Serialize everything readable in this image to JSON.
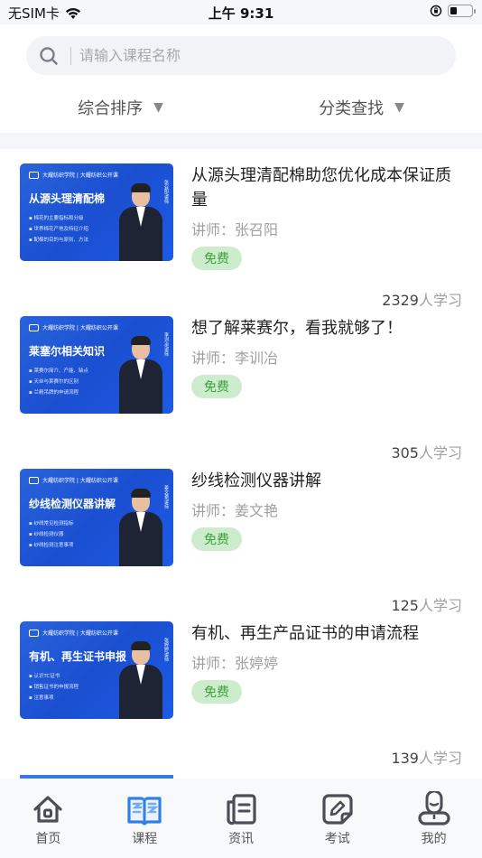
{
  "status_bar": {
    "carrier": "无SIM卡",
    "time": "上午 9:31",
    "battery_level": 0.3
  },
  "search": {
    "placeholder": "请输入课程名称",
    "value": ""
  },
  "filters": [
    {
      "label": "综合排序",
      "arrow": "▼"
    },
    {
      "label": "分类查找",
      "arrow": "▼"
    }
  ],
  "courses": [
    {
      "title": "从源头理清配棉助您优化成本保证质量",
      "lecturer": "讲师：张召阳",
      "badge": "免费",
      "learners_count": "2329",
      "learners_suffix": "人学习",
      "thumb": {
        "header": "大耀纺织学院 | 大耀纺织公开课",
        "title": "从源头理清配棉",
        "bullets": [
          "棉花的主要指标和分级",
          "世界棉花产地及特征介绍",
          "配棉的目的与原则、方法"
        ],
        "name_tag": "张召阳/讲师"
      }
    },
    {
      "title": "想了解莱赛尔，看我就够了！",
      "lecturer": "讲师：李训冶",
      "badge": "免费",
      "learners_count": "305",
      "learners_suffix": "人学习",
      "thumb": {
        "header": "大耀纺织学院 | 大耀纺织公开课",
        "title": "莱塞尔相关知识",
        "bullets": [
          "莱赛尔简介、产能、缺点",
          "天丝与莱赛尔的区别",
          "兰精吊牌的申请流程"
        ],
        "name_tag": "李训冶/讲师"
      }
    },
    {
      "title": "纱线检测仪器讲解",
      "lecturer": "讲师：姜文艳",
      "badge": "免费",
      "learners_count": "125",
      "learners_suffix": "人学习",
      "thumb": {
        "header": "大耀纺织学院 | 大耀纺织公开课",
        "title": "纱线检测仪器讲解",
        "bullets": [
          "纱线常见检测指标",
          "纱线检测仪器",
          "纱线检测注意事项"
        ],
        "name_tag": "姜文艳/讲师"
      }
    },
    {
      "title": "有机、再生产品证书的申请流程",
      "lecturer": "讲师：张婷婷",
      "badge": "免费",
      "learners_count": "139",
      "learners_suffix": "人学习",
      "thumb": {
        "header": "大耀纺织学院 | 大耀纺织公开课",
        "title": "有机、再生证书申报",
        "bullets": [
          "认识TC证书",
          "销售证书的申报流程",
          "注意事项"
        ],
        "name_tag": "张婷婷/讲师"
      }
    }
  ],
  "tabs": [
    {
      "label": "首页",
      "icon": "home-icon",
      "active": false
    },
    {
      "label": "课程",
      "icon": "book-icon",
      "active": true
    },
    {
      "label": "资讯",
      "icon": "news-icon",
      "active": false
    },
    {
      "label": "考试",
      "icon": "exam-icon",
      "active": false
    },
    {
      "label": "我的",
      "icon": "profile-icon",
      "active": false
    }
  ],
  "colors": {
    "accent": "#2f7fe6",
    "badge_bg": "#cdeccd",
    "badge_text": "#3aa33a",
    "thumb_blue": "#1a4fd0"
  }
}
